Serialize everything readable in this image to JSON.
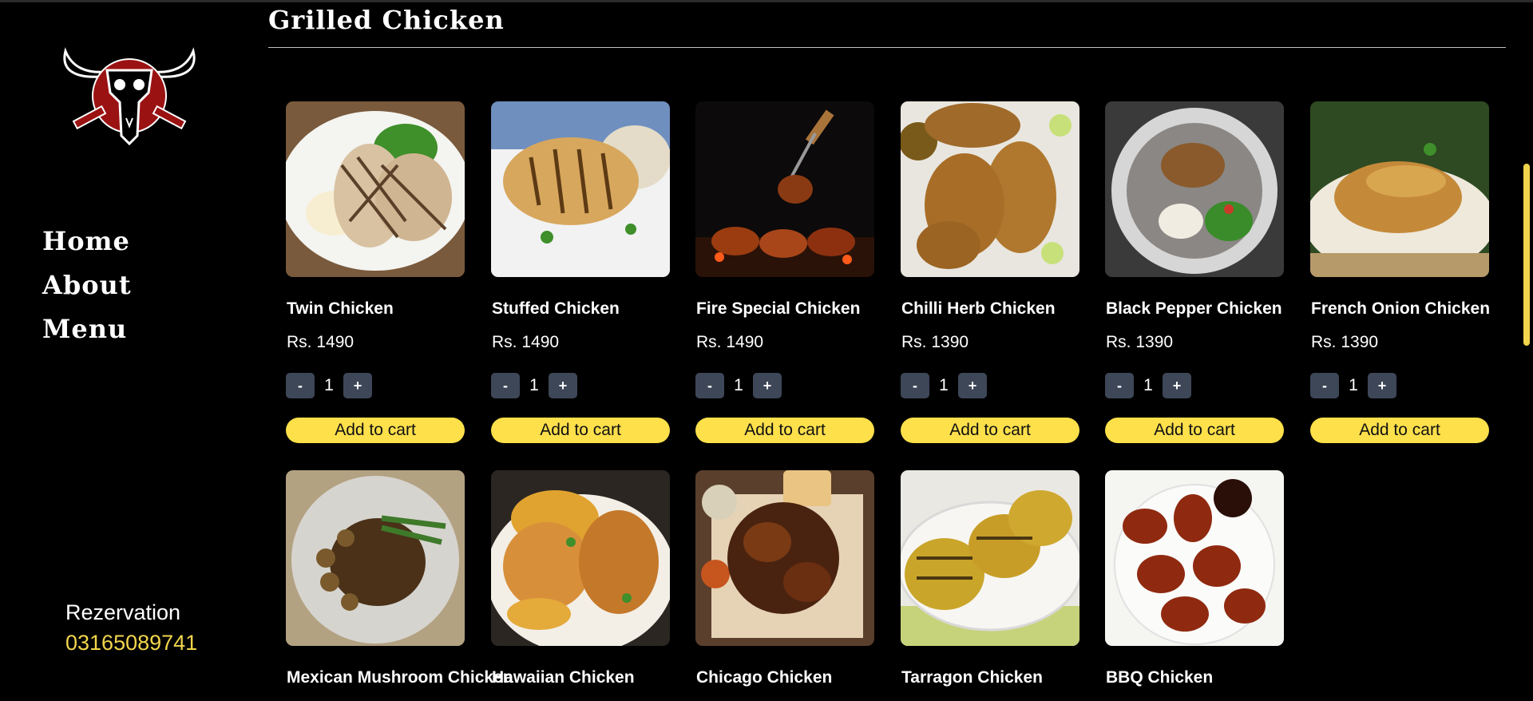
{
  "sidebar": {
    "nav": [
      "Home",
      "About",
      "Menu"
    ],
    "reservation_label": "Rezervation",
    "reservation_phone": "03165089741"
  },
  "section": {
    "title": "Grilled Chicken"
  },
  "products": [
    {
      "name": "Twin Chicken",
      "price": "Rs. 1490",
      "qty": "1",
      "add_label": "Add to cart"
    },
    {
      "name": "Stuffed Chicken",
      "price": "Rs. 1490",
      "qty": "1",
      "add_label": "Add to cart"
    },
    {
      "name": "Fire Special Chicken",
      "price": "Rs. 1490",
      "qty": "1",
      "add_label": "Add to cart"
    },
    {
      "name": "Chilli Herb Chicken",
      "price": "Rs. 1390",
      "qty": "1",
      "add_label": "Add to cart"
    },
    {
      "name": "Black Pepper Chicken",
      "price": "Rs. 1390",
      "qty": "1",
      "add_label": "Add to cart"
    },
    {
      "name": "French Onion Chicken",
      "price": "Rs. 1390",
      "qty": "1",
      "add_label": "Add to cart"
    },
    {
      "name": "Mexican Mushroom Chicken"
    },
    {
      "name": "Hawaiian Chicken"
    },
    {
      "name": "Chicago Chicken"
    },
    {
      "name": "Tarragon Chicken"
    },
    {
      "name": "BBQ Chicken"
    }
  ],
  "qty_controls": {
    "minus": "-",
    "plus": "+"
  },
  "colors": {
    "accent": "#fee04b",
    "qty_button": "#3e4758",
    "background": "#000000",
    "phone": "#f2d54c"
  }
}
